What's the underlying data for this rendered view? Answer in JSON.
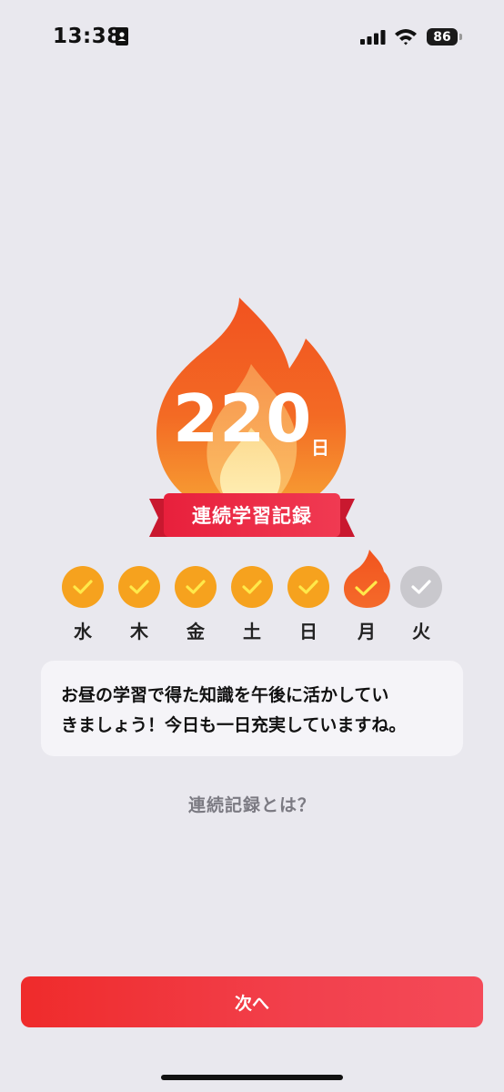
{
  "status_bar": {
    "time": "13:38",
    "battery": "86"
  },
  "streak": {
    "count": "220",
    "unit": "日",
    "label": "連続学習記録"
  },
  "week": [
    {
      "label": "水",
      "done": true,
      "today": false
    },
    {
      "label": "木",
      "done": true,
      "today": false
    },
    {
      "label": "金",
      "done": true,
      "today": false
    },
    {
      "label": "土",
      "done": true,
      "today": false
    },
    {
      "label": "日",
      "done": true,
      "today": false
    },
    {
      "label": "月",
      "done": true,
      "today": true
    },
    {
      "label": "火",
      "done": false,
      "today": false
    }
  ],
  "message": {
    "line1": "お昼の学習で得た知識を午後に活かしてい",
    "line2": "きましょう！今日も一日充実していますね。"
  },
  "about_link": "連続記録とは？",
  "next_button": "次へ",
  "colors": {
    "accent": "#ef2b2b",
    "check_done": "#f6a21e",
    "check_pending": "#c9c8cd",
    "flame": "#f4591c"
  }
}
